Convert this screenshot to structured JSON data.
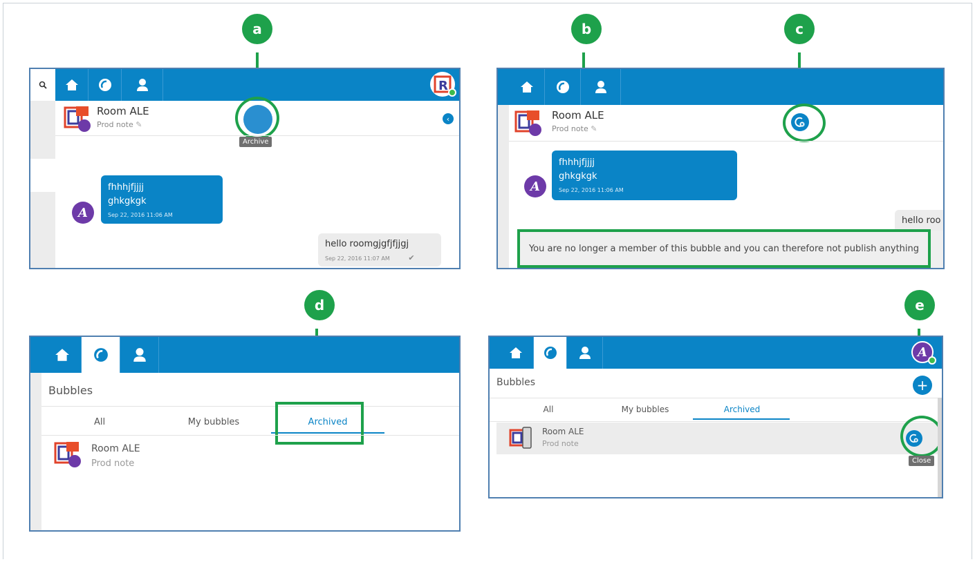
{
  "colors": {
    "brand": "#0a84c6",
    "highlight": "#1ea14b",
    "purple": "#6d3aa8"
  },
  "markers": {
    "a": "a",
    "b": "b",
    "c": "c",
    "d": "d",
    "e": "e"
  },
  "panel_a": {
    "room_name": "Room ALE",
    "room_note": "Prod note",
    "tooltip": "Archive",
    "msg_in_line1": "fhhhjfjjjj",
    "msg_in_line2": "ghkgkgk",
    "msg_in_time": "Sep 22, 2016 11:06 AM",
    "msg_out_text": "hello roomgjgfjfjjgj",
    "msg_out_time": "Sep 22, 2016 11:07 AM",
    "nav_icons": [
      "search-icon",
      "home-icon",
      "bubbles-icon",
      "contacts-icon"
    ]
  },
  "panel_b": {
    "room_name": "Room ALE",
    "room_note": "Prod note",
    "msg_in_line1": "fhhhjfjjjj",
    "msg_in_line2": "ghkgkgk",
    "msg_in_time": "Sep 22, 2016 11:06 AM",
    "msg_out_text": "hello roo",
    "notice": "You are no longer a member of this bubble and you can therefore not publish anything"
  },
  "panel_d": {
    "heading": "Bubbles",
    "tabs": [
      "All",
      "My bubbles",
      "Archived"
    ],
    "room_name": "Room ALE",
    "room_note": "Prod note"
  },
  "panel_e": {
    "heading": "Bubbles",
    "tabs": [
      "All",
      "My bubbles",
      "Archived"
    ],
    "room_name": "Room ALE",
    "room_note": "Prod note",
    "tooltip": "Close"
  }
}
